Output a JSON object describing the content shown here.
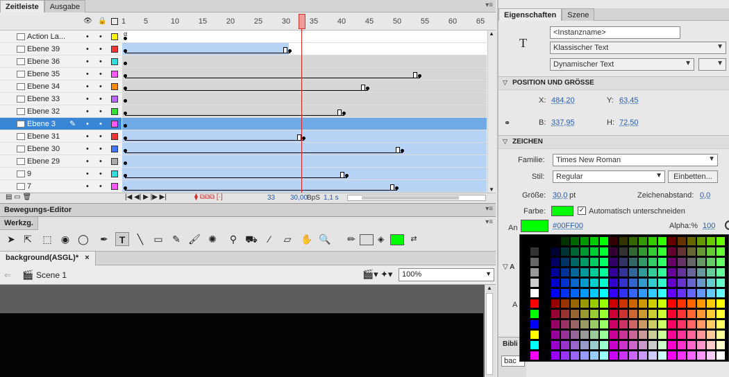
{
  "timeline_panel": {
    "tabs": [
      "Zeitleiste",
      "Ausgabe"
    ],
    "frame_numbers": [
      "1",
      "5",
      "10",
      "15",
      "20",
      "25",
      "30",
      "35",
      "40",
      "45",
      "50",
      "55",
      "60",
      "65"
    ],
    "layers": [
      {
        "name": "Action La...",
        "color": "#ffff00",
        "selected": false
      },
      {
        "name": "Ebene 39",
        "color": "#ff3333",
        "selected": false
      },
      {
        "name": "Ebene 36",
        "color": "#33dddd",
        "selected": false
      },
      {
        "name": "Ebene 35",
        "color": "#ff55ff",
        "selected": false
      },
      {
        "name": "Ebene 34",
        "color": "#ff8800",
        "selected": false
      },
      {
        "name": "Ebene 33",
        "color": "#bb66ff",
        "selected": false
      },
      {
        "name": "Ebene 32",
        "color": "#33dd33",
        "selected": false
      },
      {
        "name": "Ebene 3",
        "color": "#ff55ff",
        "selected": true
      },
      {
        "name": "Ebene 31",
        "color": "#ff3333",
        "selected": false
      },
      {
        "name": "Ebene 30",
        "color": "#4477ff",
        "selected": false
      },
      {
        "name": "Ebene 29",
        "color": "#aaaaaa",
        "selected": false
      },
      {
        "name": "9",
        "color": "#33dddd",
        "selected": false
      },
      {
        "name": "7",
        "color": "#ff55ff",
        "selected": false
      }
    ],
    "footer": {
      "current_frame": "33",
      "fps": "30,00",
      "fps_unit": "BpS",
      "elapsed": "1,1 s"
    }
  },
  "motion_editor": {
    "title": "Bewegungs-Editor"
  },
  "tools_panel": {
    "title": "Werkzg."
  },
  "document": {
    "tab_label": "background(ASGL)*",
    "tab_close": "×",
    "scene_label": "Scene 1",
    "zoom": "100%"
  },
  "properties_panel": {
    "tabs": [
      "Eigenschaften",
      "Szene"
    ],
    "instance_name_placeholder": "<Instanzname>",
    "text_engine": "Klassischer Text",
    "text_type": "Dynamischer Text",
    "position_section": "POSITION UND GRÖSSE",
    "x_label": "X:",
    "x_value": "484,20",
    "y_label": "Y:",
    "y_value": "63,45",
    "b_label": "B:",
    "b_value": "337,95",
    "h_label": "H:",
    "h_value": "72,50",
    "char_section": "ZEICHEN",
    "family_label": "Familie:",
    "family_value": "Times New Roman",
    "style_label": "Stil:",
    "style_value": "Regular",
    "embed_button": "Einbetten...",
    "size_label": "Größe:",
    "size_value": "30,0",
    "size_unit": "pt",
    "spacing_label": "Zeichenabstand:",
    "spacing_value": "0,0",
    "color_label": "Farbe:",
    "auto_kern_label": "Automatisch unterschneiden",
    "an_label": "An",
    "hex_value": "#00FF00",
    "alpha_label": "Alpha:%",
    "alpha_value": "100",
    "partial_labels": [
      "A",
      "A",
      "Bibli",
      "bac"
    ],
    "text_tool_glyph": "T"
  },
  "colors": {
    "accent": "#3a86d6",
    "fill_color": "#00ff00",
    "playhead": "#d22222"
  }
}
